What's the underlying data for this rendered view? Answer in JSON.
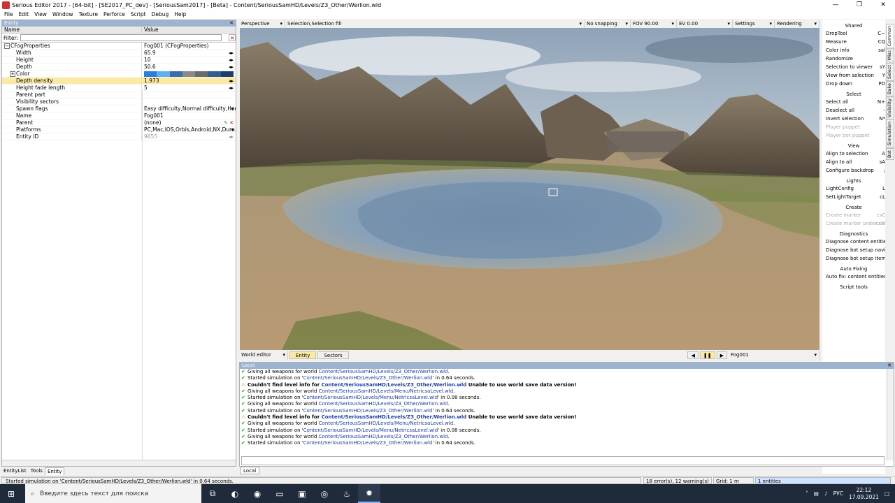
{
  "window": {
    "title": "Serious Editor 2017 - [64-bit] - [SE2017_PC_dev] - [SeriousSam2017] - [Beta] - Content/SeriousSamHD/Levels/Z3_Other/Werlion.wld",
    "minimize": "—",
    "maximize": "❐",
    "close": "✕"
  },
  "menu": [
    "File",
    "Edit",
    "View",
    "Window",
    "Texture",
    "Perforce",
    "Script",
    "Debug",
    "Help"
  ],
  "entity_panel": {
    "title": "Entity",
    "col_name": "Name",
    "col_value": "Value",
    "filter_label": "Filter:",
    "filter_clear": "✕",
    "close": "✕",
    "rows": [
      {
        "name": "CFogProperties",
        "value": "Fog001 (CFogProperties)"
      },
      {
        "name": "Width",
        "value": "65.9"
      },
      {
        "name": "Height",
        "value": "10"
      },
      {
        "name": "Depth",
        "value": "50.6"
      },
      {
        "name": "Color",
        "value": ""
      },
      {
        "name": "Depth density",
        "value": "1.973"
      },
      {
        "name": "Height fade length",
        "value": "5"
      },
      {
        "name": "Parent part",
        "value": ""
      },
      {
        "name": "Visibility sectors",
        "value": ""
      },
      {
        "name": "Spawn flags",
        "value": "Easy difficulty,Normal difficulty,Har..."
      },
      {
        "name": "Name",
        "value": "Fog001"
      },
      {
        "name": "Parent",
        "value": "(none)"
      },
      {
        "name": "Platforms",
        "value": "PC,Mac,IOS,Orbis,Android,NX,Dura..."
      },
      {
        "name": "Entity ID",
        "value": "9655"
      }
    ],
    "color_swatches": [
      "#2b7fd6",
      "#5fb0f0",
      "#3a6ea8",
      "#8a8a8a",
      "#6b6b6b",
      "#2f5f8f",
      "#1f3f6a"
    ]
  },
  "left_tabs": [
    "EntityList",
    "Tools",
    "Entity"
  ],
  "viewport_toolbar": {
    "view": "Perspective",
    "selection": "Selection,Selection fill",
    "snapping": "No snapping",
    "fov": "FOV 90.00",
    "ev": "EV  0.00",
    "settings": "Settings",
    "rendering": "Rendering"
  },
  "viewport_bottom": {
    "mode": "World editor",
    "tab_entity": "Entity",
    "tab_sectors": "Sectors",
    "prev": "◀",
    "pause": "❚❚",
    "next": "▶",
    "selected": "Fog001"
  },
  "right_panel": {
    "sections": [
      {
        "header": "Shared",
        "items": [
          {
            "label": "DropTool",
            "key": "C~"
          },
          {
            "label": "Measure",
            "key": "CQ"
          },
          {
            "label": "Color info",
            "key": "sal"
          },
          {
            "label": "Randomize",
            "key": ""
          },
          {
            "label": "Selection to viewer",
            "key": "sY"
          },
          {
            "label": "View from selection",
            "key": "Y"
          },
          {
            "label": "Drop down",
            "key": "PD"
          }
        ]
      },
      {
        "header": "Select",
        "items": [
          {
            "label": "Select all",
            "key": "N+"
          },
          {
            "label": "Deselect all",
            "key": "-"
          },
          {
            "label": "Invert selection",
            "key": "N*"
          },
          {
            "label": "Player puppet",
            "key": "",
            "disabled": true
          },
          {
            "label": "Player bot puppet",
            "key": "",
            "disabled": true
          }
        ]
      },
      {
        "header": "View",
        "items": [
          {
            "label": "Align to selection",
            "key": "A"
          },
          {
            "label": "Align to all",
            "key": "sA"
          },
          {
            "label": "Configure backdrop",
            "key": ";"
          }
        ]
      },
      {
        "header": "Lights",
        "items": [
          {
            "label": "LightConfig",
            "key": "L"
          },
          {
            "label": "SetLightTarget",
            "key": "cL"
          }
        ]
      },
      {
        "header": "Create",
        "items": [
          {
            "label": "Create marker",
            "key": "csC",
            "disabled": true
          },
          {
            "label": "Create marker under cu",
            "key": "csM",
            "disabled": true
          }
        ]
      },
      {
        "header": "Diagnostics",
        "items": [
          {
            "label": "Diagnose content entities",
            "key": ""
          },
          {
            "label": "Diagnose bot setup naviga",
            "key": ""
          },
          {
            "label": "Diagnose bot setup items",
            "key": ""
          }
        ]
      },
      {
        "header": "Auto Fixing",
        "items": [
          {
            "label": "Auto fix: content entities",
            "key": ""
          }
        ]
      },
      {
        "header": "Script tools",
        "items": []
      }
    ],
    "vertical_tabs": [
      "Common",
      "Misc",
      "Select",
      "Bake",
      "Visibility",
      "Simulation",
      "Bot"
    ]
  },
  "log": {
    "title": "Local",
    "close": "✕",
    "lines": [
      {
        "type": "ok",
        "pre": "Giving all weapons for world ",
        "link": "Content/SeriousSamHD/Levels/Z3_Other/Werlion.wld",
        "post": "."
      },
      {
        "type": "ok",
        "pre": "Started simulation on '",
        "link": "Content/SeriousSamHD/Levels/Z3_Other/Werlion.wld",
        "post": "' in 0.64 seconds."
      },
      {
        "type": "warn",
        "pre": "Couldn't find level info for ",
        "link": "Content/SeriousSamHD/Levels/Z3_Other/Werlion.wld",
        "post": " Unable to use world save data version!"
      },
      {
        "type": "ok",
        "pre": "Giving all weapons for world ",
        "link": "Content/SeriousSamHD/Levels/Menu/NetricsaLevel.wld",
        "post": "."
      },
      {
        "type": "ok",
        "pre": "Started simulation on '",
        "link": "Content/SeriousSamHD/Levels/Menu/NetricsaLevel.wld",
        "post": "' in 0.08 seconds."
      },
      {
        "type": "ok",
        "pre": "Giving all weapons for world ",
        "link": "Content/SeriousSamHD/Levels/Z3_Other/Werlion.wld",
        "post": "."
      },
      {
        "type": "ok",
        "pre": "Started simulation on '",
        "link": "Content/SeriousSamHD/Levels/Z3_Other/Werlion.wld",
        "post": "' in 0.64 seconds."
      },
      {
        "type": "warn",
        "pre": "Couldn't find level info for ",
        "link": "Content/SeriousSamHD/Levels/Z3_Other/Werlion.wld",
        "post": " Unable to use world save data version!"
      },
      {
        "type": "ok",
        "pre": "Giving all weapons for world ",
        "link": "Content/SeriousSamHD/Levels/Menu/NetricsaLevel.wld",
        "post": "."
      },
      {
        "type": "ok",
        "pre": "Started simulation on '",
        "link": "Content/SeriousSamHD/Levels/Menu/NetricsaLevel.wld",
        "post": "' in 0.08 seconds."
      },
      {
        "type": "ok",
        "pre": "Giving all weapons for world ",
        "link": "Content/SeriousSamHD/Levels/Z3_Other/Werlion.wld",
        "post": "."
      },
      {
        "type": "ok",
        "pre": "Started simulation on '",
        "link": "Content/SeriousSamHD/Levels/Z3_Other/Werlion.wld",
        "post": "' in 0.64 seconds."
      }
    ],
    "tab": "Local"
  },
  "status": {
    "message": "Started simulation on 'Content/SeriousSamHD/Levels/Z3_Other/Werlion.wld' in 0.64 seconds.",
    "errors": "18 error(s), 12 warning(s)",
    "grid": "Grid: 1 m",
    "entities": "1 entities"
  },
  "taskbar": {
    "search_placeholder": "Введите здесь текст для поиска",
    "lang": "РУС",
    "time": "22:12",
    "date": "17.09.2021"
  }
}
